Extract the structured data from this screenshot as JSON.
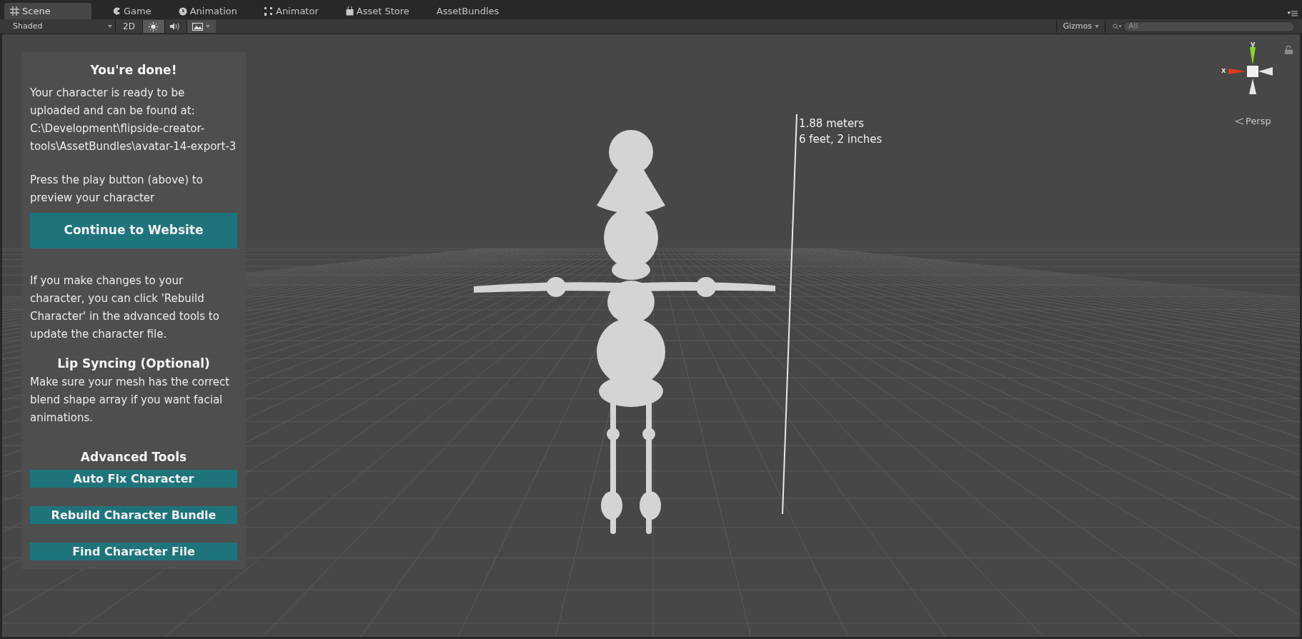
{
  "tabs": [
    {
      "label": "Scene",
      "selected": true
    },
    {
      "label": "Game",
      "selected": false
    },
    {
      "label": "Animation",
      "selected": false
    },
    {
      "label": "Animator",
      "selected": false
    },
    {
      "label": "Asset Store",
      "selected": false
    },
    {
      "label": "AssetBundles",
      "selected": false
    }
  ],
  "toolbar": {
    "shading_mode": "Shaded",
    "mode_2d": {
      "label": "2D",
      "on": false
    },
    "lighting_on": true,
    "audio_on": false,
    "effects_on": false,
    "gizmos": "Gizmos",
    "search": {
      "placeholder": "All"
    }
  },
  "scene": {
    "measurement": [
      "1.88 meters",
      "6 feet, 2 inches"
    ],
    "gizmo": {
      "y_label": "y",
      "x_label": "x",
      "view": "Persp"
    }
  },
  "panel": {
    "title": "You're done!",
    "ready_text": "Your character is ready to be uploaded and can be found at: C:\\Development\\flipside-creator-tools\\AssetBundles\\avatar-14-export-3",
    "play_text": "Press the play button (above) to preview your character",
    "website_button": "Continue to Website",
    "rebuild_text": "If you make changes to your character, you can click 'Rebuild Character' in the advanced tools to update the character file.",
    "lip_title": "Lip Syncing (Optional)",
    "lip_text": "Make sure your mesh has the correct blend shape array if you want facial animations.",
    "advanced_title": "Advanced Tools",
    "advanced_buttons": [
      "Auto Fix Character",
      "Rebuild Character Bundle",
      "Find Character File"
    ]
  }
}
